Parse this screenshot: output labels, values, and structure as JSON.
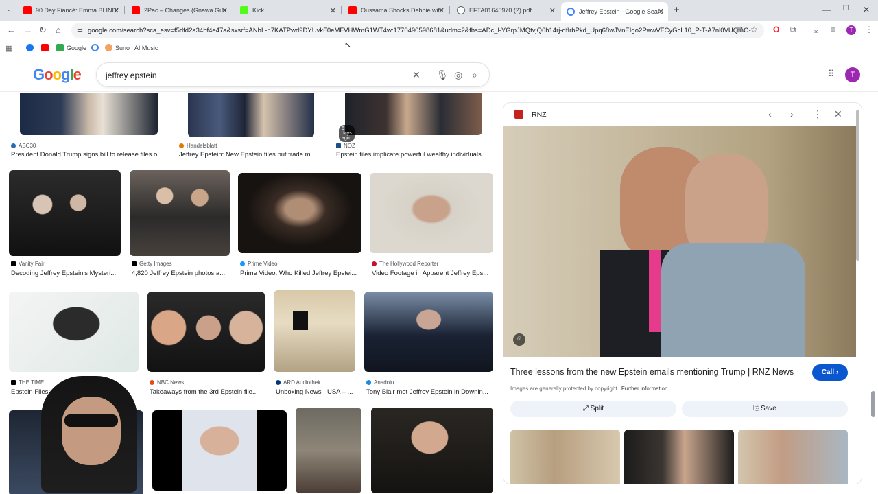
{
  "browser": {
    "tabs": [
      {
        "title": "90 Day Fiancé: Emma BLINDSID",
        "favicon_color": "#ff0000"
      },
      {
        "title": "2Pac – Changes (Gnawa Guem",
        "favicon_color": "#ff0000"
      },
      {
        "title": "Kick",
        "favicon_color": "#53fc18"
      },
      {
        "title": "Oussama Shocks Debbie with a",
        "favicon_color": "#ff0000"
      },
      {
        "title": "EFTA01645970 (2).pdf",
        "favicon_color": "#5f6368"
      },
      {
        "title": "Jeffrey Epstein - Google Search",
        "favicon_color": "#4285f4"
      }
    ],
    "url": "google.com/search?sca_esv=f5dfd2a34bf4e47a&sxsrf=ANbL-n7KATPwd9DYUvkF0eMFVHWmG1WT4w:1770490598681&udm=2&fbs=ADc_l-YGrpJMQtvjQ6h14rj-dfIrbPkd_Upq68wJVnEIgo2PwwVFCyGcL10_P-T-A7nl0VUQfnO-...",
    "bookmarks": [
      {
        "label": "",
        "color": "#1877f2"
      },
      {
        "label": "",
        "color": "#ff0000"
      },
      {
        "label": "Google",
        "color": "#34a853"
      },
      {
        "label": "",
        "color": "#4285f4"
      },
      {
        "label": "Suno | AI Music",
        "color": "#f4a261"
      }
    ]
  },
  "search": {
    "query": "jeffrey epstein",
    "avatar_letter": "T"
  },
  "results": [
    {
      "source": "ABC30",
      "caption": "President Donald Trump signs bill to release files o...",
      "source_color": "#2b6cb0"
    },
    {
      "source": "Handelsblatt",
      "caption": "Jeffrey Epstein: New Epstein files put trade mi...",
      "source_color": "#e07b00"
    },
    {
      "source": "NOZ",
      "caption": "Epstein files implicate powerful wealthy individuals ...",
      "source_color": "#1a4f8b",
      "badge": "6 days ago"
    },
    {
      "source": "Vanity Fair",
      "caption": "Decoding Jeffrey Epstein's Mysteri...",
      "source_color": "#000000"
    },
    {
      "source": "Getty Images",
      "caption": "4,820 Jeffrey Epstein photos a...",
      "source_color": "#000000"
    },
    {
      "source": "Prime Video",
      "caption": "Prime Video: Who Killed Jeffrey Epstei...",
      "source_color": "#1a98ff"
    },
    {
      "source": "The Hollywood Reporter",
      "caption": "Video Footage in Apparent Jeffrey Eps...",
      "source_color": "#c41230"
    },
    {
      "source": "THE TIME",
      "caption": "Epstein Files: ...",
      "source_color": "#000000"
    },
    {
      "source": "NBC News",
      "caption": "Takeaways from the 3rd Epstein file...",
      "source_color": "#e64a19"
    },
    {
      "source": "ARD Audiothek",
      "caption": "Unboxing News · USA – ...",
      "source_color": "#003480"
    },
    {
      "source": "Anadolu",
      "caption": "Tony Blair met Jeffrey Epstein in Downin...",
      "source_color": "#1e88e5"
    }
  ],
  "panel": {
    "source": "RNZ",
    "title": "Three lessons from the new Epstein emails mentioning Trump | RNZ News",
    "call_label": "Call",
    "copyright": "Images are generally protected by copyright.",
    "further_info": "Further information",
    "split_label": "Split",
    "save_label": "Save"
  }
}
